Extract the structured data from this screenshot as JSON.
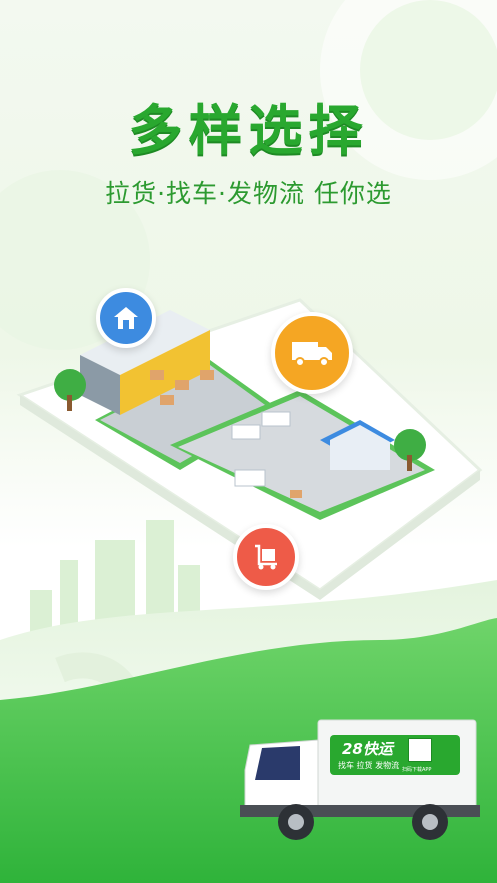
{
  "headline": "多样选择",
  "subline": "拉货·找车·发物流 任你选",
  "truck_brand": {
    "name": "28快运",
    "services": "找车 拉货 发物流",
    "qr_caption": "扫码下载APP"
  },
  "colors": {
    "brand_green": "#29a82f",
    "accent_orange": "#f5a623",
    "accent_red": "#ee5b48",
    "accent_blue": "#3d8be0"
  },
  "icons": [
    "house-icon",
    "truck-icon",
    "cart-icon"
  ]
}
